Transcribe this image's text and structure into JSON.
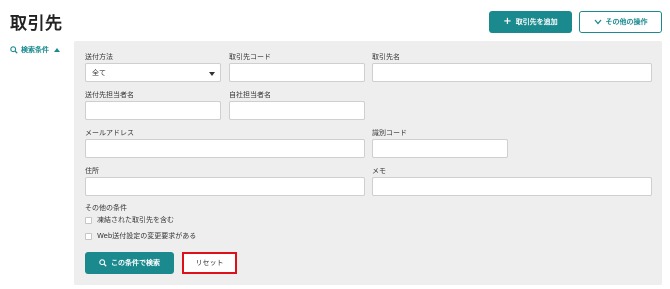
{
  "page": {
    "title": "取引先"
  },
  "header": {
    "add_button_label": "取引先を追加",
    "other_ops_label": "その他の操作"
  },
  "search_toggle": {
    "label": "検索条件"
  },
  "form": {
    "send_method": {
      "label": "送付方法",
      "value": "全て"
    },
    "partner_code": {
      "label": "取引先コード",
      "value": ""
    },
    "partner_name": {
      "label": "取引先名",
      "value": ""
    },
    "partner_contact": {
      "label": "送付先担当者名",
      "value": ""
    },
    "own_contact": {
      "label": "自社担当者名",
      "value": ""
    },
    "email": {
      "label": "メールアドレス",
      "value": ""
    },
    "id_code": {
      "label": "識別コード",
      "value": ""
    },
    "address": {
      "label": "住所",
      "value": ""
    },
    "memo": {
      "label": "メモ",
      "value": ""
    },
    "other_conditions": {
      "label": "その他の条件",
      "options": [
        {
          "label": "凍結された取引先を含む",
          "checked": false
        },
        {
          "label": "Web送付設定の変更要求がある",
          "checked": false
        }
      ]
    }
  },
  "actions": {
    "search_label": "この条件で検索",
    "reset_label": "リセット"
  },
  "colors": {
    "accent": "#1a8a8f",
    "panel_bg": "#eeeeee",
    "highlight": "#e0101b"
  }
}
